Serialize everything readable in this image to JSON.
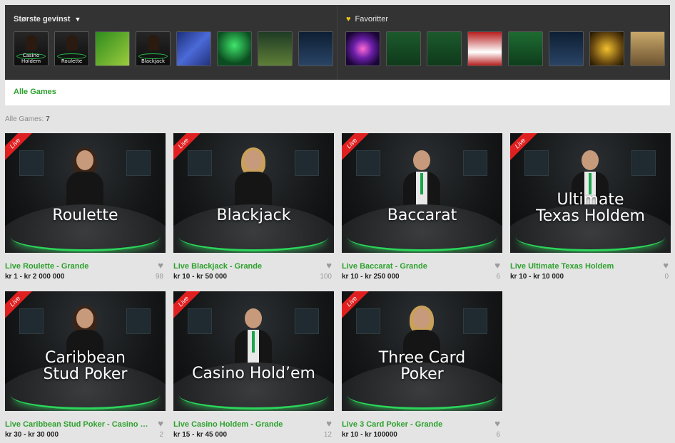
{
  "top_panel": {
    "left_title": "Største gevinst",
    "right_title": "Favoritter",
    "left_thumbs": [
      {
        "caption": "Casino Holdem",
        "icon": "dealer-thumb",
        "style": "t-dark"
      },
      {
        "caption": "Roulette",
        "icon": "dealer-thumb",
        "style": "t-dark"
      },
      {
        "caption": "",
        "icon": "green-man-thumb",
        "style": "t-greenman"
      },
      {
        "caption": "Blackjack",
        "icon": "dealer-thumb",
        "style": "t-dark"
      },
      {
        "caption": "",
        "icon": "slot-thumb",
        "style": "t-blue"
      },
      {
        "caption": "",
        "icon": "lantern-thumb",
        "style": "t-lantern"
      },
      {
        "caption": "",
        "icon": "slot-thumb",
        "style": "t-forest"
      },
      {
        "caption": "",
        "icon": "romance-thumb",
        "style": "t-romance"
      }
    ],
    "right_thumbs": [
      {
        "caption": "",
        "icon": "starburst-thumb",
        "style": "t-starburst"
      },
      {
        "caption": "",
        "icon": "felt-table-thumb",
        "style": "t-felt"
      },
      {
        "caption": "",
        "icon": "felt-table-thumb",
        "style": "t-felt"
      },
      {
        "caption": "",
        "icon": "card-thumb",
        "style": "t-red"
      },
      {
        "caption": "",
        "icon": "blackjack-thumb",
        "style": "t-bj"
      },
      {
        "caption": "",
        "icon": "romance-thumb",
        "style": "t-romance"
      },
      {
        "caption": "",
        "icon": "roses-thumb",
        "style": "t-roses"
      },
      {
        "caption": "",
        "icon": "aztec-thumb",
        "style": "t-aztec"
      }
    ]
  },
  "nav": {
    "all_games": "Alle Games"
  },
  "count": {
    "label": "Alle Games:",
    "value": "7"
  },
  "live_badge": "Live",
  "games": [
    {
      "overlay": [
        "Roulette"
      ],
      "title": "Live Roulette - Grande",
      "stakes": "kr 1 - kr 2 000 000",
      "likes": "98",
      "dealer": "female-dark"
    },
    {
      "overlay": [
        "Blackjack"
      ],
      "title": "Live Blackjack - Grande",
      "stakes": "kr 10 - kr 50 000",
      "likes": "100",
      "dealer": "female-blonde"
    },
    {
      "overlay": [
        "Baccarat"
      ],
      "title": "Live Baccarat - Grande",
      "stakes": "kr 10 - kr 250 000",
      "likes": "6",
      "dealer": "male"
    },
    {
      "overlay": [
        "Ultimate",
        "Texas Holdem"
      ],
      "title": "Live Ultimate Texas Holdem",
      "stakes": "kr 10 - kr 10 000",
      "likes": "0",
      "dealer": "male"
    },
    {
      "overlay": [
        "Caribbean",
        "Stud Poker"
      ],
      "title": "Live Caribbean Stud Poker - Casino Grande",
      "stakes": "kr 30 - kr 30 000",
      "likes": "2",
      "dealer": "female-dark"
    },
    {
      "overlay": [
        "Casino Hold’em"
      ],
      "title": "Live Casino Holdem - Grande",
      "stakes": "kr 15 - kr 45 000",
      "likes": "12",
      "dealer": "male"
    },
    {
      "overlay": [
        "Three Card",
        "Poker"
      ],
      "title": "Live 3 Card Poker - Grande",
      "stakes": "kr 10 - kr 100000",
      "likes": "6",
      "dealer": "female-blonde"
    }
  ],
  "colors": {
    "accent_green": "#2ea12e",
    "live_red": "#e02020",
    "favorite_yellow": "#f0c419"
  }
}
